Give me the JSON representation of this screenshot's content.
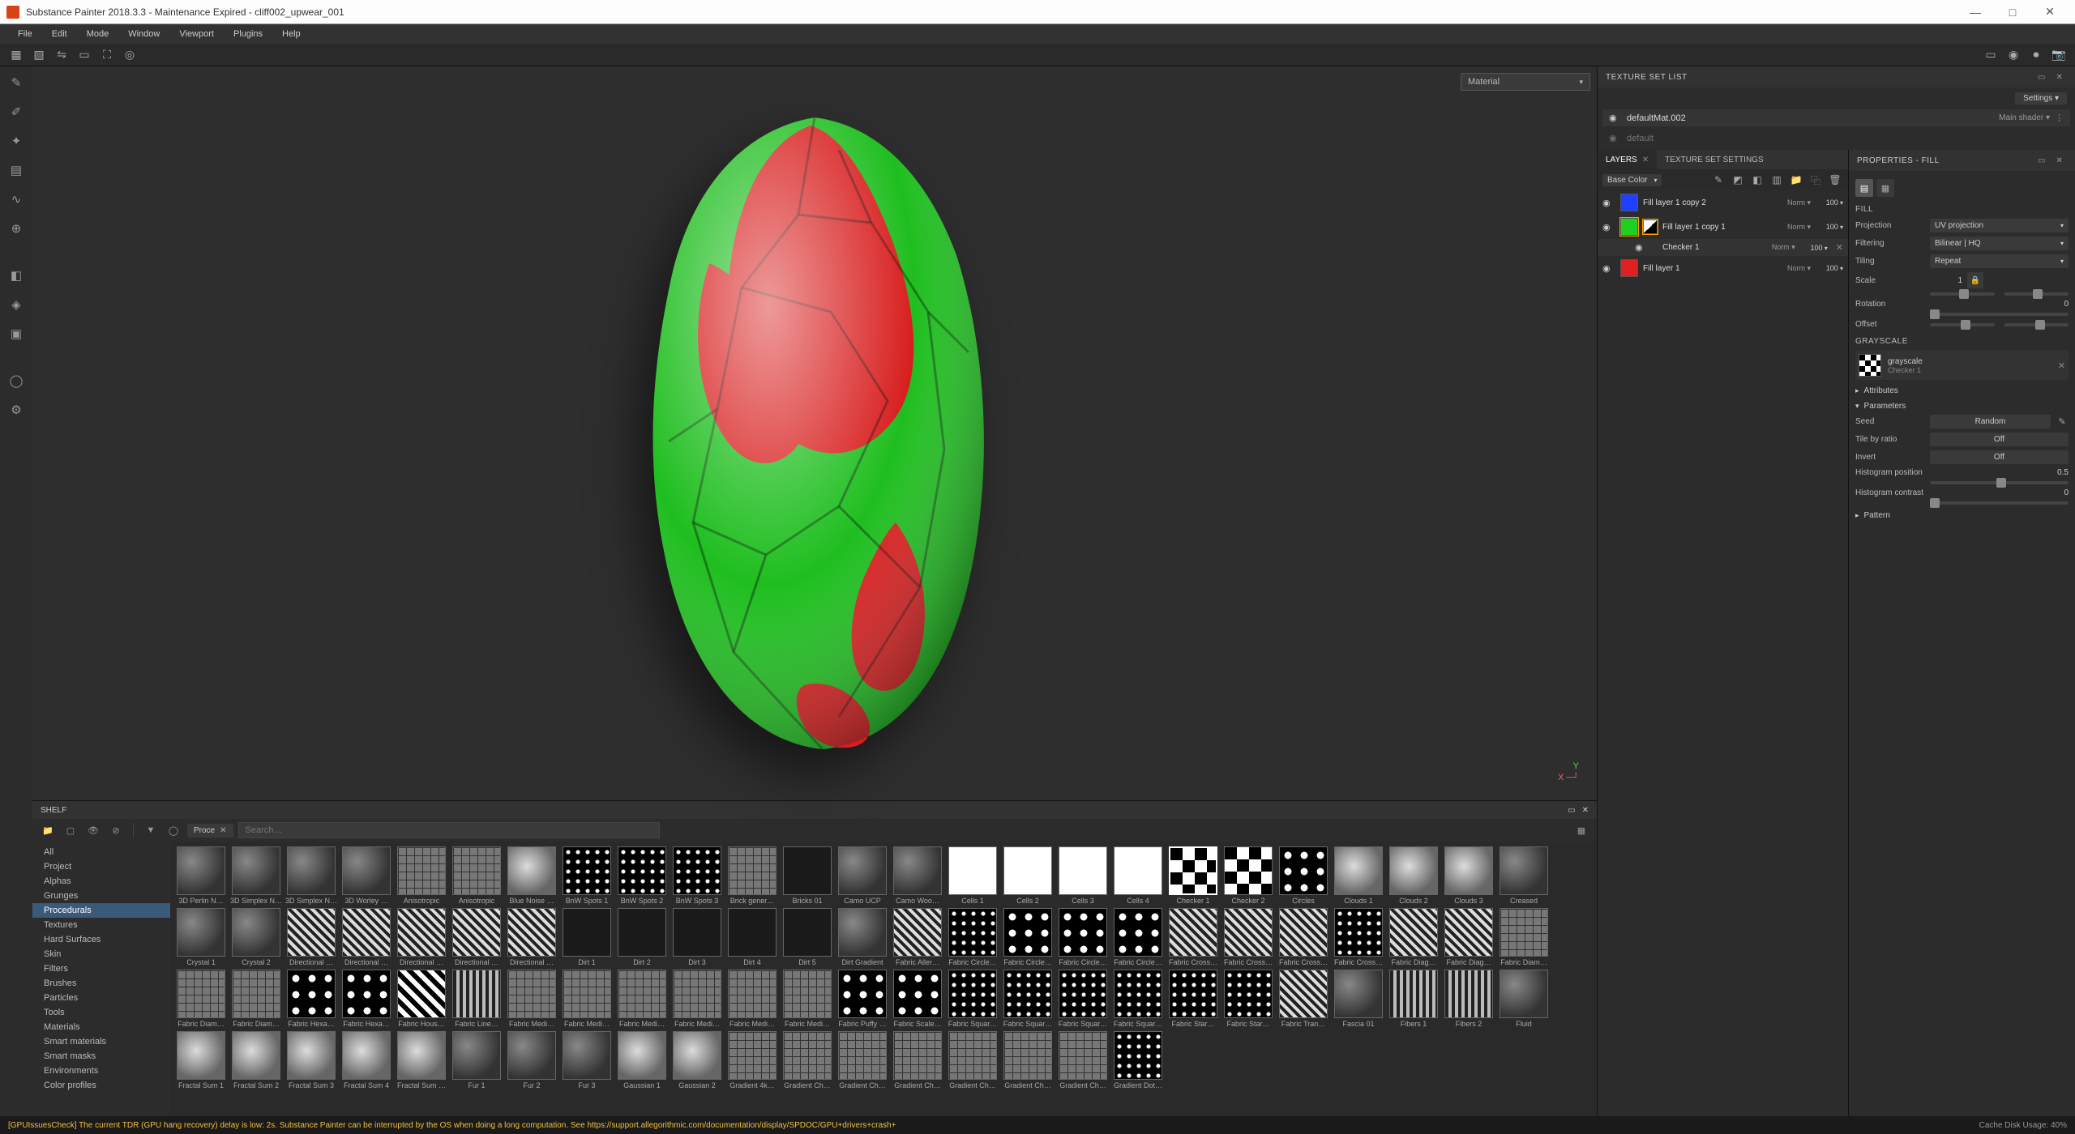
{
  "title": "Substance Painter 2018.3.3 - Maintenance Expired - cliff002_upwear_001",
  "menu": [
    "File",
    "Edit",
    "Mode",
    "Window",
    "Viewport",
    "Plugins",
    "Help"
  ],
  "material_dropdown": "Material",
  "texture_set_list": {
    "title": "TEXTURE SET LIST",
    "settings": "Settings ▾",
    "items": [
      {
        "name": "defaultMat.002",
        "shader": "Main shader ▾",
        "visible": true
      },
      {
        "name": "default",
        "shader": "",
        "visible": false
      }
    ]
  },
  "layers_panel": {
    "tabs": [
      "LAYERS",
      "TEXTURE SET SETTINGS"
    ],
    "channel": "Base Color",
    "layers": [
      {
        "color": "#2040ff",
        "name": "Fill layer 1 copy 2",
        "blend": "Norm",
        "opacity": "100"
      },
      {
        "color": "#20d020",
        "mask": true,
        "name": "Fill layer 1 copy 1",
        "blend": "Norm",
        "opacity": "100",
        "selected": true,
        "children": [
          {
            "name": "Checker 1",
            "blend": "Norm",
            "opacity": "100"
          }
        ]
      },
      {
        "color": "#e02020",
        "name": "Fill layer 1",
        "blend": "Norm",
        "opacity": "100"
      }
    ]
  },
  "properties": {
    "title": "PROPERTIES - FILL",
    "fill_section": "FILL",
    "projection_label": "Projection",
    "projection_value": "UV projection",
    "filtering_label": "Filtering",
    "filtering_value": "Bilinear | HQ",
    "tiling_label": "Tiling",
    "tiling_value": "Repeat",
    "scale_label": "Scale",
    "scale_value": "1",
    "rotation_label": "Rotation",
    "rotation_value": "0",
    "offset_label": "Offset",
    "grayscale_section": "GRAYSCALE",
    "grayscale_name": "grayscale",
    "grayscale_sub": "Checker 1",
    "attributes_label": "Attributes",
    "parameters_label": "Parameters",
    "seed_label": "Seed",
    "seed_value": "Random",
    "tilebyratio_label": "Tile by ratio",
    "tilebyratio_value": "Off",
    "invert_label": "Invert",
    "invert_value": "Off",
    "histpos_label": "Histogram position",
    "histpos_value": "0.5",
    "histcon_label": "Histogram contrast",
    "histcon_value": "0",
    "pattern_label": "Pattern"
  },
  "shelf": {
    "title": "SHELF",
    "filter_pill": "Proce",
    "search_placeholder": "Search…",
    "categories": [
      "All",
      "Project",
      "Alphas",
      "Grunges",
      "Procedurals",
      "Textures",
      "Hard Surfaces",
      "Skin",
      "Filters",
      "Brushes",
      "Particles",
      "Tools",
      "Materials",
      "Smart materials",
      "Smart masks",
      "Environments",
      "Color profiles"
    ],
    "selected_category": "Procedurals",
    "thumbs": [
      "3D Perlin N…",
      "3D Simplex N…",
      "3D Simplex N…",
      "3D Worley …",
      "Anisotropic",
      "Anisotropic",
      "Blue Noise …",
      "BnW Spots 1",
      "BnW Spots 2",
      "BnW Spots 3",
      "Brick gener…",
      "Bricks 01",
      "Camo UCP",
      "Camo Woo…",
      "Cells 1",
      "Cells 2",
      "Cells 3",
      "Cells 4",
      "Checker 1",
      "Checker 2",
      "Circles",
      "Clouds 1",
      "Clouds 2",
      "Clouds 3",
      "Creased",
      "Crystal 1",
      "Crystal 2",
      "Directional …",
      "Directional …",
      "Directional …",
      "Directional …",
      "Directional …",
      "Dirt 1",
      "Dirt 2",
      "Dirt 3",
      "Dirt 4",
      "Dirt 5",
      "Dirt Gradient",
      "Fabric Aller…",
      "Fabric Circle…",
      "Fabric Circle…",
      "Fabric Circle…",
      "Fabric Circle…",
      "Fabric Cross…",
      "Fabric Cross…",
      "Fabric Cross…",
      "Fabric Cross…",
      "Fabric Diag…",
      "Fabric Diag…",
      "Fabric Diam…",
      "Fabric Diam…",
      "Fabric Diam…",
      "Fabric Hexa…",
      "Fabric Hexa…",
      "Fabric Hous…",
      "Fabric Line…",
      "Fabric Medi…",
      "Fabric Medi…",
      "Fabric Medi…",
      "Fabric Medi…",
      "Fabric Medi…",
      "Fabric Medi…",
      "Fabric Puffy …",
      "Fabric Scale…",
      "Fabric Squar…",
      "Fabric Squar…",
      "Fabric Squar…",
      "Fabric Squar…",
      "Fabric Star…",
      "Fabric Star…",
      "Fabric Tran…",
      "Fascia 01",
      "Fibers 1",
      "Fibers 2",
      "Fluid",
      "Fractal Sum 1",
      "Fractal Sum 2",
      "Fractal Sum 3",
      "Fractal Sum 4",
      "Fractal Sum …",
      "Fur 1",
      "Fur 2",
      "Fur 3",
      "Gaussian 1",
      "Gaussian 2",
      "Gradient 4k…",
      "Gradient Ch…",
      "Gradient Ch…",
      "Gradient Ch…",
      "Gradient Ch…",
      "Gradient Ch…",
      "Gradient Ch…",
      "Gradient Dot…"
    ]
  },
  "status": {
    "warn": "[GPUIssuesCheck] The current TDR (GPU hang recovery) delay is low: 2s. Substance Painter can be interrupted by the OS when doing a long computation. See https://support.allegorithmic.com/documentation/display/SPDOC/GPU+drivers+crash+",
    "right": "Cache Disk Usage:   40%"
  }
}
